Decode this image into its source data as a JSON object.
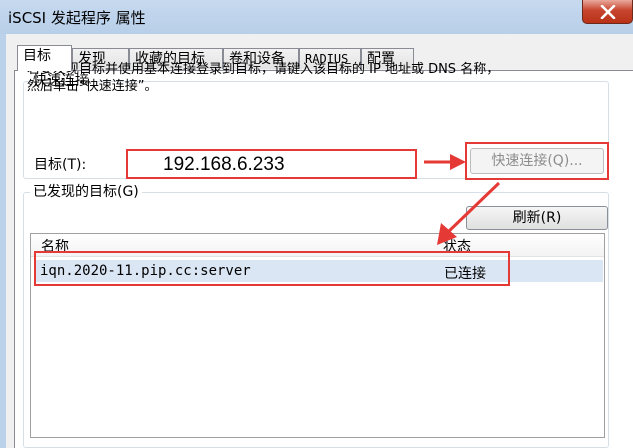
{
  "window": {
    "title": "iSCSI 发起程序 属性"
  },
  "tabs": [
    {
      "label": "目标",
      "active": true
    },
    {
      "label": "发现"
    },
    {
      "label": "收藏的目标"
    },
    {
      "label": "卷和设备"
    },
    {
      "label": "RADIUS"
    },
    {
      "label": "配置"
    }
  ],
  "quick_connect": {
    "group_label": "快速连接",
    "description_line1": "若要发现目标并使用基本连接登录到目标，请键入该目标的 IP 地址或 DNS 名称，",
    "description_line2": "然后单击“快速连接”。",
    "target_label": "目标(T):",
    "target_value": "192.168.6.233",
    "button_label": "快速连接(Q)..."
  },
  "discovered": {
    "group_label": "已发现的目标(G)",
    "refresh_label": "刷新(R)",
    "columns": [
      "名称",
      "状态"
    ],
    "rows": [
      {
        "name": "iqn.2020-11.pip.cc:server",
        "status": "已连接"
      }
    ]
  },
  "colors": {
    "highlight": "#e53935",
    "selected_row": "#dbe6f4"
  }
}
